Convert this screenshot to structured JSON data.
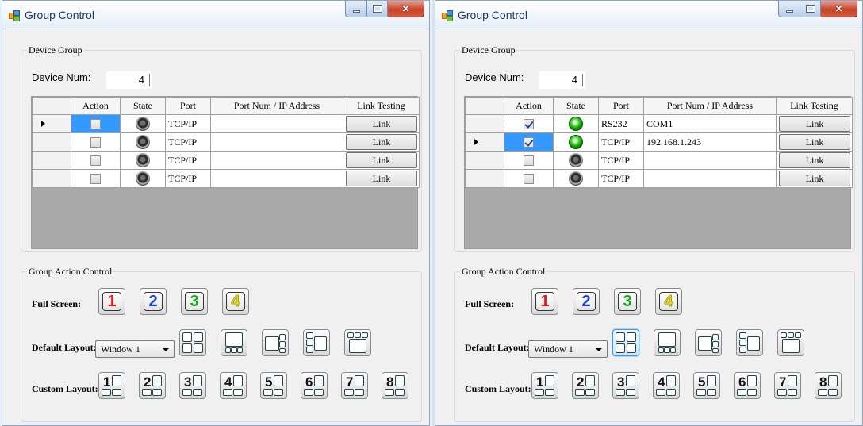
{
  "colors": {
    "titlebar": "#e6eef8",
    "selection": "#3399ff",
    "led_on": "#1ea412",
    "led_off": "#2a2a2a",
    "close_button": "#c7442a"
  },
  "windows": [
    {
      "title": "Group Control",
      "device_group": {
        "label": "Device Group",
        "device_num_label": "Device Num:",
        "device_num_value": "4",
        "columns": [
          "Action",
          "State",
          "Port",
          "Port Num / IP Address",
          "Link Testing"
        ],
        "rows": [
          {
            "current": true,
            "action_checked": false,
            "state": "off",
            "port": "TCP/IP",
            "address": "",
            "link": "Link"
          },
          {
            "current": false,
            "action_checked": false,
            "state": "off",
            "port": "TCP/IP",
            "address": "",
            "link": "Link"
          },
          {
            "current": false,
            "action_checked": false,
            "state": "off",
            "port": "TCP/IP",
            "address": "",
            "link": "Link"
          },
          {
            "current": false,
            "action_checked": false,
            "state": "off",
            "port": "TCP/IP",
            "address": "",
            "link": "Link"
          }
        ]
      },
      "group_action": {
        "label": "Group Action Control",
        "full_screen_label": "Full Screen:",
        "full_screen_buttons": [
          "1",
          "2",
          "3",
          "4"
        ],
        "default_layout_label": "Default Layout:",
        "window_select_value": "Window 1",
        "default_layout_highlighted": false,
        "default_layouts": [
          "quad-layout-icon",
          "one-plus-three-layout-icon",
          "one-plus-two-right-layout-icon",
          "two-left-one-layout-icon",
          "three-top-one-layout-icon"
        ],
        "custom_layout_label": "Custom Layout:",
        "custom_layouts": [
          "1",
          "2",
          "3",
          "4",
          "5",
          "6",
          "7",
          "8"
        ]
      }
    },
    {
      "title": "Group Control",
      "device_group": {
        "label": "Device Group",
        "device_num_label": "Device Num:",
        "device_num_value": "4",
        "columns": [
          "Action",
          "State",
          "Port",
          "Port Num / IP Address",
          "Link Testing"
        ],
        "rows": [
          {
            "current": false,
            "action_checked": true,
            "state": "on",
            "port": "RS232",
            "address": "COM1",
            "link": "Link"
          },
          {
            "current": true,
            "action_checked": true,
            "state": "on",
            "port": "TCP/IP",
            "address": "192.168.1.243",
            "link": "Link"
          },
          {
            "current": false,
            "action_checked": false,
            "state": "off",
            "port": "TCP/IP",
            "address": "",
            "link": "Link"
          },
          {
            "current": false,
            "action_checked": false,
            "state": "off",
            "port": "TCP/IP",
            "address": "",
            "link": "Link"
          }
        ]
      },
      "group_action": {
        "label": "Group Action Control",
        "full_screen_label": "Full Screen:",
        "full_screen_buttons": [
          "1",
          "2",
          "3",
          "4"
        ],
        "default_layout_label": "Default Layout:",
        "window_select_value": "Window 1",
        "default_layout_highlighted": true,
        "default_layouts": [
          "quad-layout-icon",
          "one-plus-three-layout-icon",
          "one-plus-two-right-layout-icon",
          "two-left-one-layout-icon",
          "three-top-one-layout-icon"
        ],
        "custom_layout_label": "Custom Layout:",
        "custom_layouts": [
          "1",
          "2",
          "3",
          "4",
          "5",
          "6",
          "7",
          "8"
        ]
      }
    }
  ]
}
